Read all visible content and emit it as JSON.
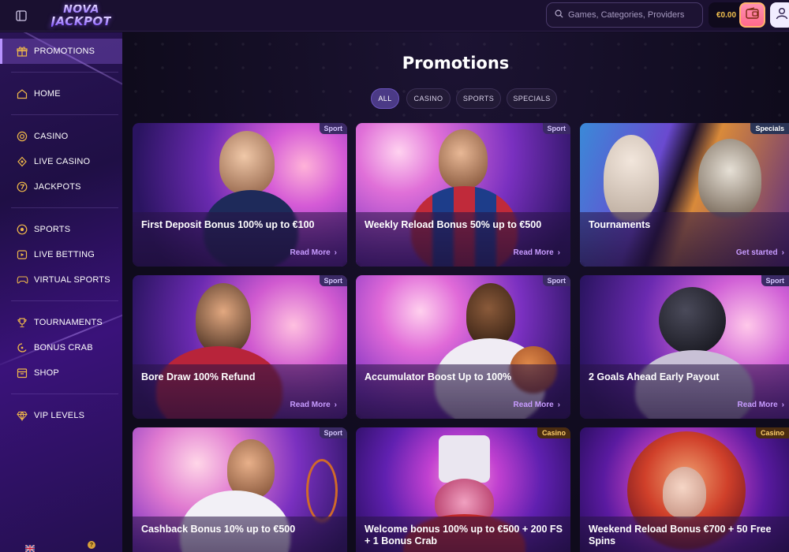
{
  "header": {
    "logo_line1": "NOVA",
    "logo_line2": "JACKPOT",
    "search_placeholder": "Games, Categories, Providers",
    "balance": "€0.00"
  },
  "sidebar": {
    "items": [
      {
        "label": "PROMOTIONS",
        "icon": "gift-icon"
      },
      {
        "label": "HOME",
        "icon": "home-icon"
      },
      {
        "label": "CASINO",
        "icon": "casino-chip-icon"
      },
      {
        "label": "LIVE CASINO",
        "icon": "live-casino-icon"
      },
      {
        "label": "JACKPOTS",
        "icon": "jackpot-seven-icon"
      },
      {
        "label": "SPORTS",
        "icon": "soccer-ball-icon"
      },
      {
        "label": "LIVE BETTING",
        "icon": "live-betting-icon"
      },
      {
        "label": "VIRTUAL SPORTS",
        "icon": "gamepad-icon"
      },
      {
        "label": "TOURNAMENTS",
        "icon": "trophy-icon"
      },
      {
        "label": "BONUS CRAB",
        "icon": "crab-icon"
      },
      {
        "label": "SHOP",
        "icon": "shop-icon"
      },
      {
        "label": "VIP LEVELS",
        "icon": "diamond-icon"
      }
    ],
    "help": "?"
  },
  "main": {
    "title": "Promotions",
    "filters": [
      "ALL",
      "CASINO",
      "SPORTS",
      "SPECIALS"
    ],
    "active_filter": "ALL",
    "cards": [
      {
        "badge": "Sport",
        "title": "First Deposit Bonus 100% up to €100",
        "cta": "Read More"
      },
      {
        "badge": "Sport",
        "title": "Weekly Reload Bonus 50% up to €500",
        "cta": "Read More"
      },
      {
        "badge": "Specials",
        "title": "Tournaments",
        "cta": "Get started"
      },
      {
        "badge": "Sport",
        "title": "Bore Draw 100% Refund",
        "cta": "Read More"
      },
      {
        "badge": "Sport",
        "title": "Accumulator Boost Up to 100%",
        "cta": "Read More"
      },
      {
        "badge": "Sport",
        "title": "2 Goals Ahead Early Payout",
        "cta": "Read More"
      },
      {
        "badge": "Sport",
        "title": "Cashback Bonus 10% up to €500",
        "cta": ""
      },
      {
        "badge": "Casino",
        "title": "Welcome bonus 100% up to €500 + 200 FS + 1 Bonus Crab",
        "cta": ""
      },
      {
        "badge": "Casino",
        "title": "Weekend Reload Bonus €700 + 50 Free Spins",
        "cta": ""
      }
    ]
  },
  "colors": {
    "accent": "#c79bff",
    "balance": "#f2c14e",
    "sidebar_active": "#b893ff"
  }
}
